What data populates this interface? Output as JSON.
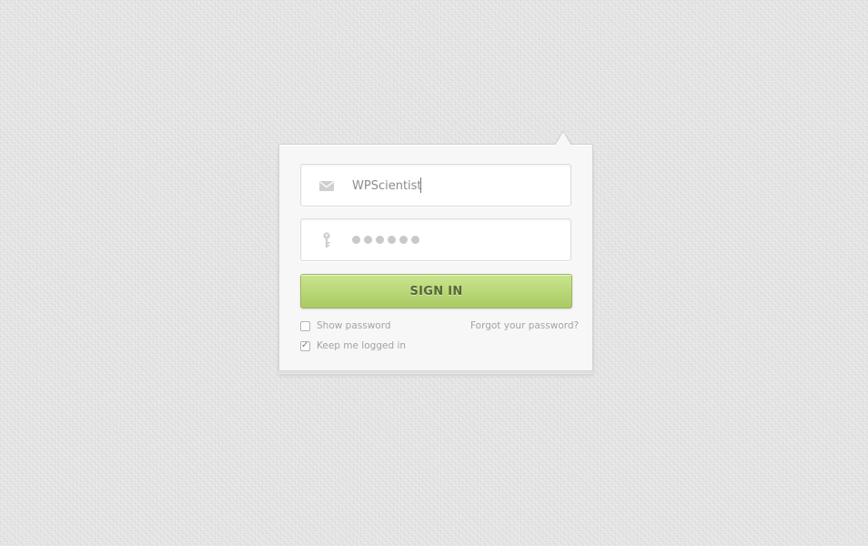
{
  "login": {
    "username": {
      "value": "WPScientist",
      "icon": "envelope-icon"
    },
    "password": {
      "masked_dots": 6,
      "icon": "key-icon"
    },
    "submit_label": "SIGN IN",
    "show_password_label": "Show password",
    "show_password_checked": false,
    "keep_logged_in_label": "Keep me logged in",
    "keep_logged_in_checked": true,
    "forgot_password_label": "Forgot your password?"
  },
  "colors": {
    "accent": "#b8d776",
    "accent_text": "#56673a",
    "background": "#e6e6e6",
    "card": "#f7f7f7"
  }
}
